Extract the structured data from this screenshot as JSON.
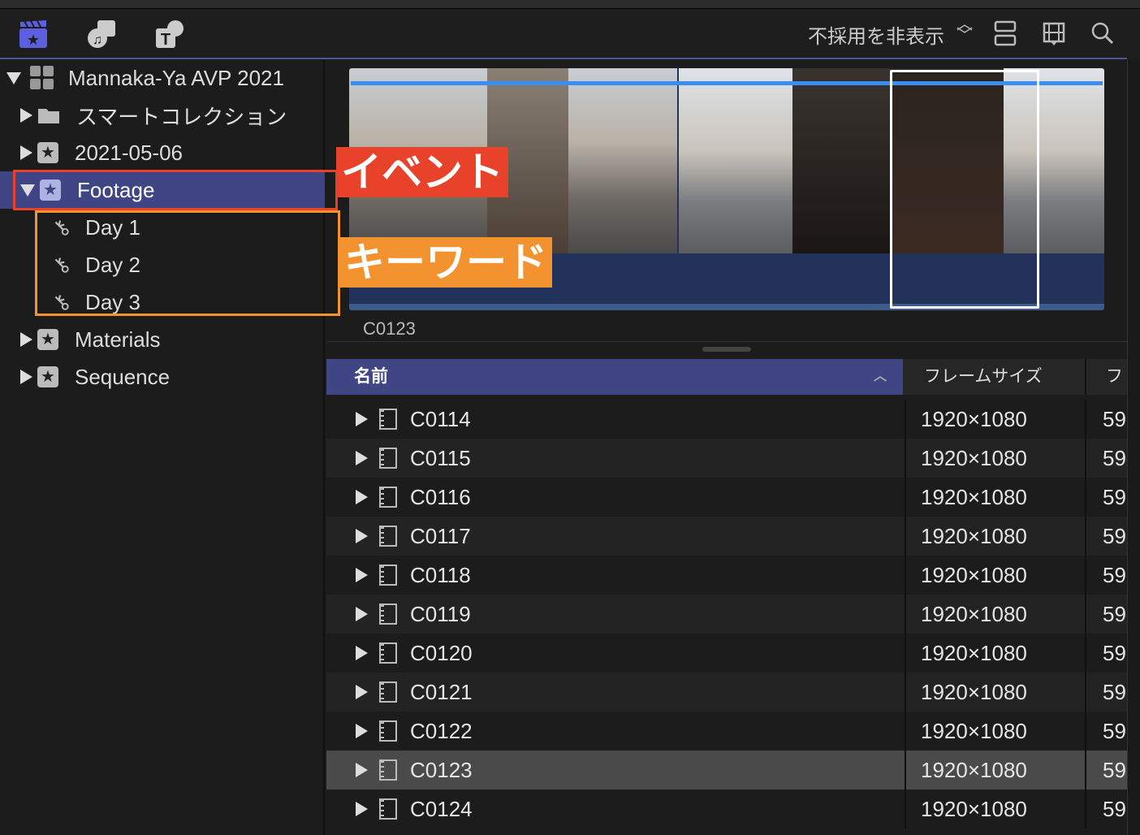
{
  "toolbar": {
    "icons": [
      "libraries-icon",
      "photos-audio-icon",
      "titles-generators-icon"
    ],
    "filter_label": "不採用を非表示",
    "right_icons": [
      "clip-appearance-icon",
      "filmstrip-view-icon",
      "search-icon"
    ]
  },
  "sidebar": {
    "library": "Mannaka-Ya AVP 2021",
    "items": [
      {
        "label": "スマートコレクション",
        "type": "folder"
      },
      {
        "label": "2021-05-06",
        "type": "event"
      },
      {
        "label": "Footage",
        "type": "event",
        "selected": true
      },
      {
        "label": "Day 1",
        "type": "keyword"
      },
      {
        "label": "Day 2",
        "type": "keyword"
      },
      {
        "label": "Day 3",
        "type": "keyword"
      },
      {
        "label": "Materials",
        "type": "event"
      },
      {
        "label": "Sequence",
        "type": "event"
      }
    ]
  },
  "viewer": {
    "clip_label": "C0123"
  },
  "table": {
    "headers": [
      "名前",
      "フレームサイズ",
      "フ"
    ],
    "rows": [
      {
        "name": "C0114",
        "size": "1920×1080",
        "fr": "59"
      },
      {
        "name": "C0115",
        "size": "1920×1080",
        "fr": "59"
      },
      {
        "name": "C0116",
        "size": "1920×1080",
        "fr": "59"
      },
      {
        "name": "C0117",
        "size": "1920×1080",
        "fr": "59"
      },
      {
        "name": "C0118",
        "size": "1920×1080",
        "fr": "59"
      },
      {
        "name": "C0119",
        "size": "1920×1080",
        "fr": "59"
      },
      {
        "name": "C0120",
        "size": "1920×1080",
        "fr": "59"
      },
      {
        "name": "C0121",
        "size": "1920×1080",
        "fr": "59"
      },
      {
        "name": "C0122",
        "size": "1920×1080",
        "fr": "59"
      },
      {
        "name": "C0123",
        "size": "1920×1080",
        "fr": "59",
        "selected": true
      },
      {
        "name": "C0124",
        "size": "1920×1080",
        "fr": "59"
      }
    ]
  },
  "annotations": {
    "event": "イベント",
    "keyword": "キーワード",
    "event_color": "#e8432a",
    "keyword_color": "#f3932f"
  }
}
